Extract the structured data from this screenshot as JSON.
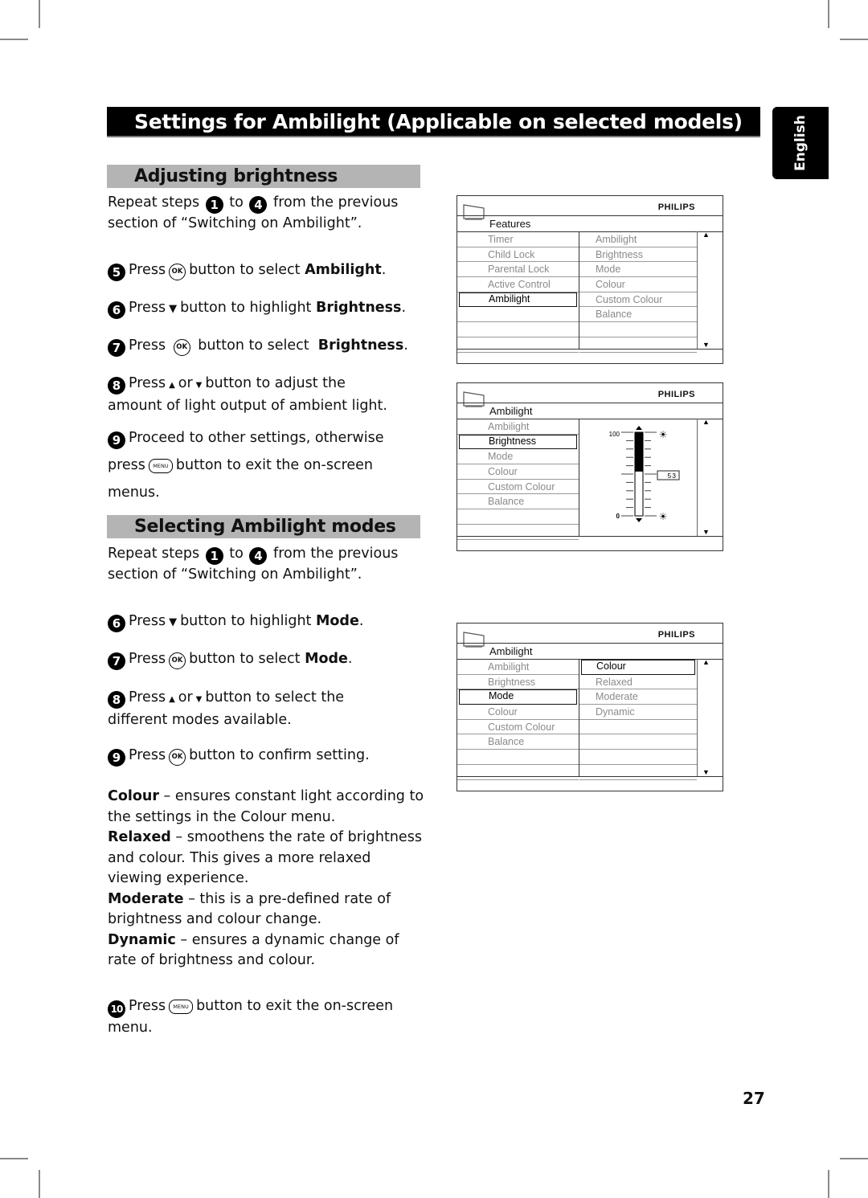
{
  "page": {
    "title": "Settings for Ambilight (Applicable on selected models)",
    "language_tab": "English",
    "page_number": "27"
  },
  "section_brightness": {
    "heading": "Adjusting brightness",
    "intro": {
      "before": "Repeat steps",
      "from_step": "1",
      "to": "to",
      "to_step": "4",
      "after": "from the previous",
      "line2": "section of “Switching on Ambilight”."
    },
    "steps": [
      {
        "num": "5",
        "press": "Press",
        "button": "OK",
        "text": "button to select",
        "bold": "Ambilight",
        "end": "."
      },
      {
        "num": "6",
        "press": "Press",
        "button": "down-arrow",
        "text": "button to highlight",
        "bold": "Brightness",
        "end": "."
      },
      {
        "num": "7",
        "press": "Press",
        "button": "OK",
        "text": "button to select",
        "bold": "Brightness",
        "end": "."
      },
      {
        "num": "8",
        "press": "Press",
        "up": "▲",
        "or": "or",
        "down": "▼",
        "text": "button to adjust the",
        "line2": "amount of light output of ambient light."
      },
      {
        "num": "9",
        "text": "Proceed to other settings, otherwise",
        "press": "press",
        "button": "MENU",
        "text2": "button to exit the on-screen",
        "line3": "menus."
      }
    ]
  },
  "section_modes": {
    "heading": "Selecting Ambilight modes",
    "intro": {
      "before": "Repeat steps",
      "from_step": "1",
      "to": "to",
      "to_step": "4",
      "after": "from the previous",
      "line2": "section of “Switching on Ambilight”."
    },
    "steps": [
      {
        "num": "6",
        "press": "Press",
        "button": "down-arrow",
        "text": "button to highlight",
        "bold": "Mode",
        "end": "."
      },
      {
        "num": "7",
        "press": "Press",
        "button": "OK",
        "text": "button to select",
        "bold": "Mode",
        "end": "."
      },
      {
        "num": "8",
        "press": "Press",
        "up": "▲",
        "or": "or",
        "down": "▼",
        "text": "button to select the",
        "line2": "different modes available."
      },
      {
        "num": "9",
        "press": "Press",
        "button": "OK",
        "text": "button to confirm setting."
      }
    ],
    "modes": [
      {
        "name": "Colour",
        "desc": " – ensures constant light according to the settings in the Colour menu."
      },
      {
        "name": "Relaxed",
        "desc": " – smoothens the rate of brightness and colour. This gives a more relaxed viewing experience."
      },
      {
        "name": "Moderate",
        "desc": " – this is a pre-defined rate of brightness and colour change."
      },
      {
        "name": "Dynamic",
        "desc": " – ensures a dynamic change of rate of brightness and colour."
      }
    ],
    "final_step": {
      "num": "10",
      "press": "Press",
      "button": "MENU",
      "text": "button to exit the on-screen",
      "line2": "menu."
    }
  },
  "buttons": {
    "ok": "OK",
    "menu": "MENU",
    "down": "▼"
  },
  "tv_menus": [
    {
      "brand": "PHILIPS",
      "title": "Features",
      "left": [
        "Timer",
        "Child Lock",
        "Parental Lock",
        "Active Control",
        "Ambilight",
        "",
        "",
        ""
      ],
      "left_selected": 4,
      "right": [
        "Ambilight",
        "Brightness",
        "Mode",
        "Colour",
        "Custom Colour",
        "Balance",
        "",
        ""
      ],
      "right_selected": -1
    },
    {
      "brand": "PHILIPS",
      "title": "Ambilight",
      "left": [
        "Ambilight",
        "Brightness",
        "Mode",
        "Colour",
        "Custom Colour",
        "Balance",
        "",
        ""
      ],
      "left_selected": 1,
      "slider": {
        "max_label": "100",
        "min_label": "0",
        "value": "53",
        "fill_fraction": 0.53
      }
    },
    {
      "brand": "PHILIPS",
      "title": "Ambilight",
      "left": [
        "Ambilight",
        "Brightness",
        "Mode",
        "Colour",
        "Custom Colour",
        "Balance",
        "",
        ""
      ],
      "left_selected": 2,
      "right": [
        "Colour",
        "Relaxed",
        "Moderate",
        "Dynamic",
        "",
        "",
        "",
        ""
      ],
      "right_selected": 0
    }
  ]
}
